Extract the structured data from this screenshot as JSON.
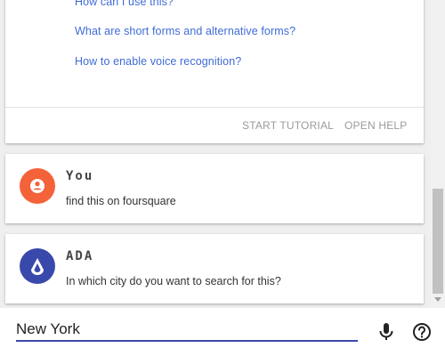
{
  "help": {
    "links": [
      "How can I use this?",
      "What are short forms and alternative forms?",
      "How to enable voice recognition?"
    ],
    "start_tutorial": "START TUTORIAL",
    "open_help": "OPEN HELP"
  },
  "messages": [
    {
      "sender": "You",
      "text": "find this on foursquare",
      "avatar_color": "#f4623a",
      "avatar_icon": "user-icon"
    },
    {
      "sender": "ADA",
      "text": "In which city do you want to search for this?",
      "avatar_color": "#3949ab",
      "avatar_icon": "ada-logo-icon"
    }
  ],
  "input": {
    "value": "New York"
  },
  "colors": {
    "accent": "#3949ab",
    "link": "#3f6bd6"
  }
}
